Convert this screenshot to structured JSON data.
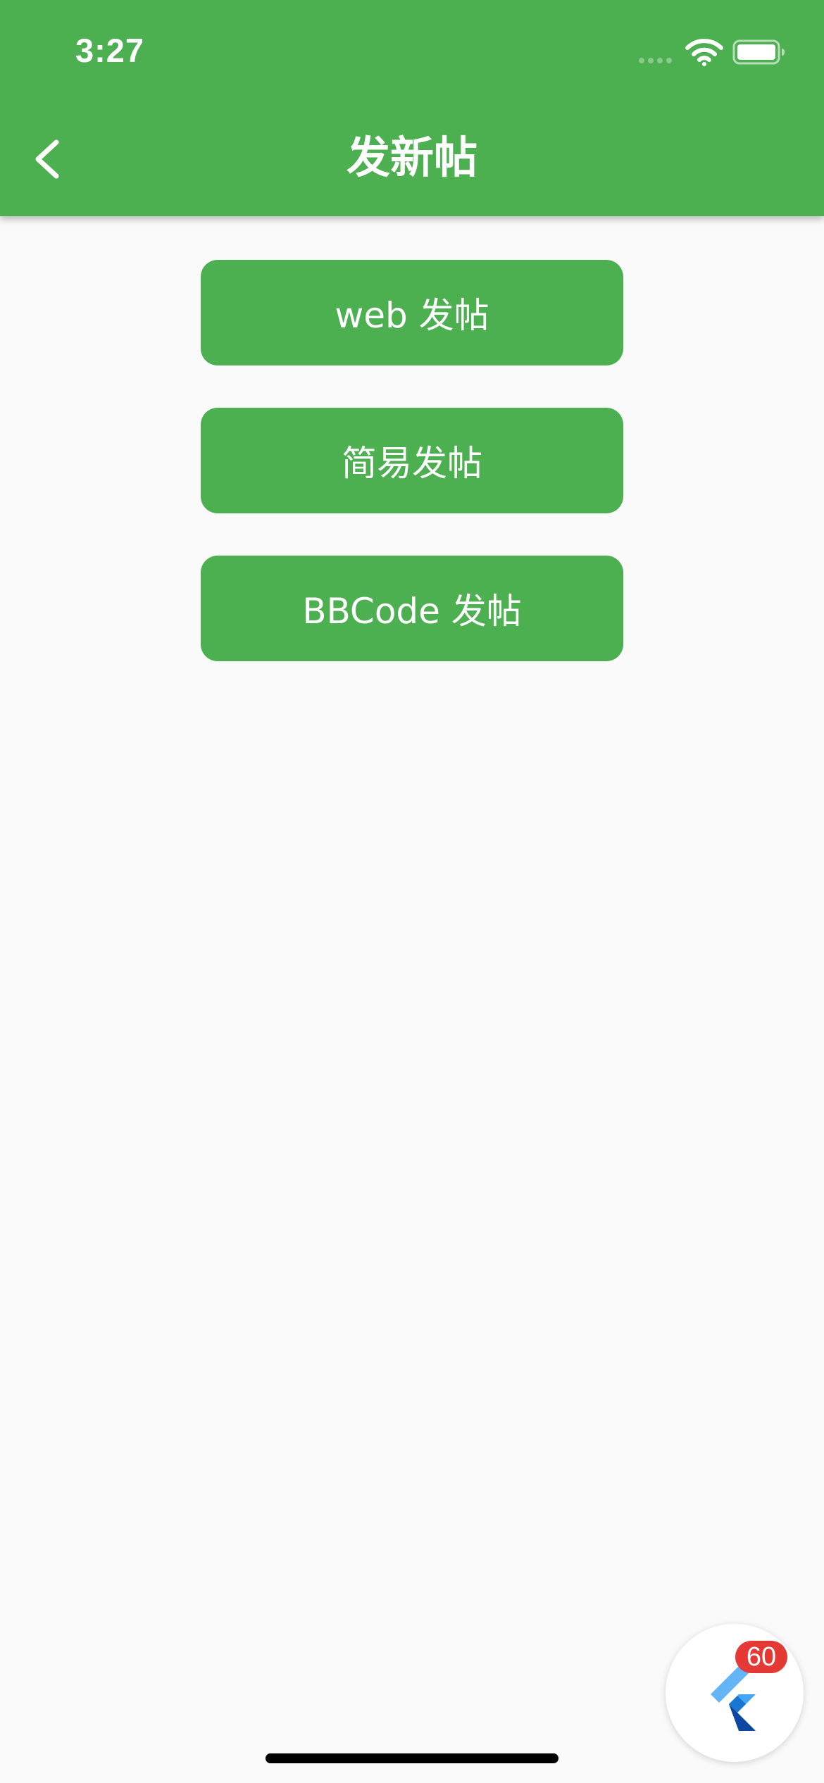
{
  "status_bar": {
    "time": "3:27"
  },
  "app_bar": {
    "title": "发新帖",
    "back_icon": "chevron-left-icon",
    "background_color": "#4caf50"
  },
  "actions": [
    {
      "label": "web 发帖"
    },
    {
      "label": "简易发帖"
    },
    {
      "label": "BBCode 发帖"
    }
  ],
  "floating_button": {
    "icon": "flutter-logo-icon",
    "badge": "60",
    "badge_color": "#e53935"
  },
  "colors": {
    "accent": "#4caf50",
    "background": "#fafafa"
  }
}
